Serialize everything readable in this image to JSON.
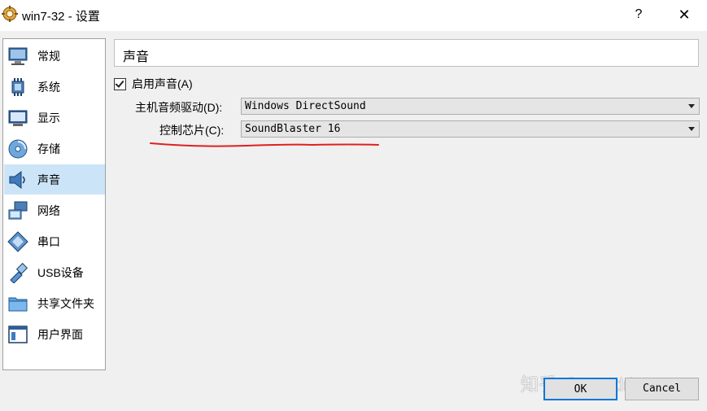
{
  "window": {
    "title": "win7-32 - 设置",
    "help_label": "?",
    "close_label": "✕"
  },
  "sidebar": {
    "items": [
      {
        "label": "常规",
        "icon": "monitor-icon"
      },
      {
        "label": "系统",
        "icon": "chip-icon"
      },
      {
        "label": "显示",
        "icon": "display-icon"
      },
      {
        "label": "存储",
        "icon": "disk-icon"
      },
      {
        "label": "声音",
        "icon": "speaker-icon",
        "selected": true
      },
      {
        "label": "网络",
        "icon": "network-icon"
      },
      {
        "label": "串口",
        "icon": "serial-port-icon"
      },
      {
        "label": "USB设备",
        "icon": "usb-icon"
      },
      {
        "label": "共享文件夹",
        "icon": "folder-icon"
      },
      {
        "label": "用户界面",
        "icon": "window-icon"
      }
    ]
  },
  "audio": {
    "section_title": "声音",
    "enable_label": "启用声音(A)",
    "enable_checked": true,
    "host_driver_label": "主机音频驱动(D):",
    "host_driver_value": "Windows DirectSound",
    "controller_label": "控制芯片(C):",
    "controller_value": "SoundBlaster 16"
  },
  "buttons": {
    "ok_label": "OK",
    "cancel_label": "Cancel"
  },
  "watermark": "知乎 @satadriver",
  "colors": {
    "selected_bg": "#cce4f7",
    "accent": "#0078d7",
    "annotation_red": "#e02020"
  }
}
